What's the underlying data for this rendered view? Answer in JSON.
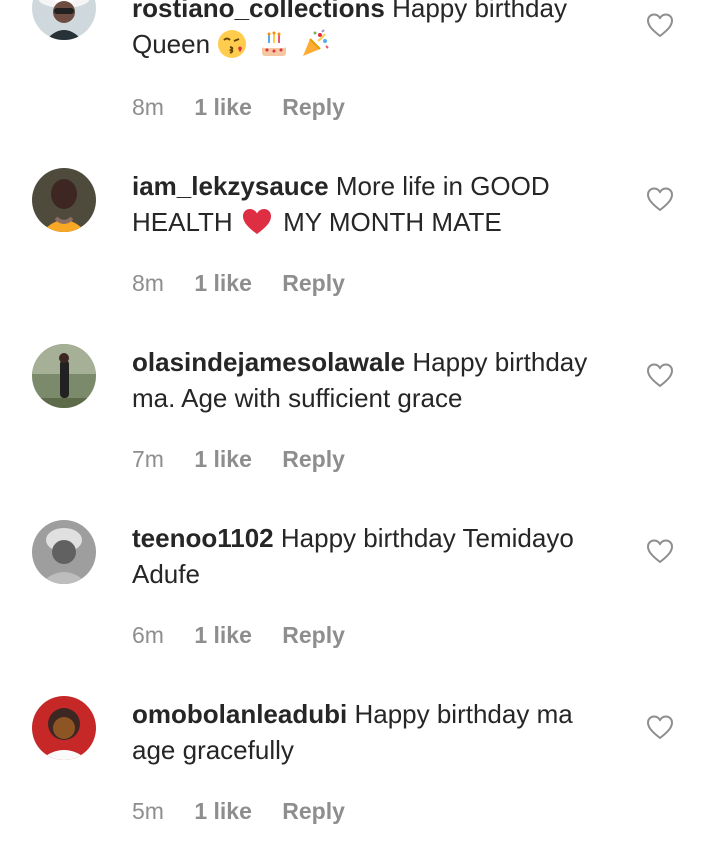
{
  "comments": [
    {
      "username": "rostiano_collections",
      "text": "Happy birthday Queen",
      "emoji_names": [
        "kissing-face-emoji",
        "birthday-cake-emoji",
        "party-popper-emoji"
      ],
      "time": "8m",
      "likes": "1 like",
      "reply": "Reply"
    },
    {
      "username": "iam_lekzysauce",
      "text_before": "More life in GOOD HEALTH",
      "emoji_names": [
        "red-heart-emoji"
      ],
      "text_after": "MY MONTH MATE",
      "time": "8m",
      "likes": "1 like",
      "reply": "Reply"
    },
    {
      "username": "olasindejamesolawale",
      "text": "Happy birthday ma. Age with sufficient grace",
      "time": "7m",
      "likes": "1 like",
      "reply": "Reply"
    },
    {
      "username": "teenoo1102",
      "text": "Happy birthday Temidayo Adufe",
      "time": "6m",
      "likes": "1 like",
      "reply": "Reply"
    },
    {
      "username": "omobolanleadubi",
      "text": "Happy birthday ma age gracefully",
      "time": "5m",
      "likes": "1 like",
      "reply": "Reply"
    }
  ],
  "icons": {
    "like": "heart-outline-icon"
  },
  "colors": {
    "text": "#262626",
    "secondary": "#8e8e8e",
    "heart_stroke": "#8e8e8e",
    "emoji_heart": "#dd2e44"
  }
}
